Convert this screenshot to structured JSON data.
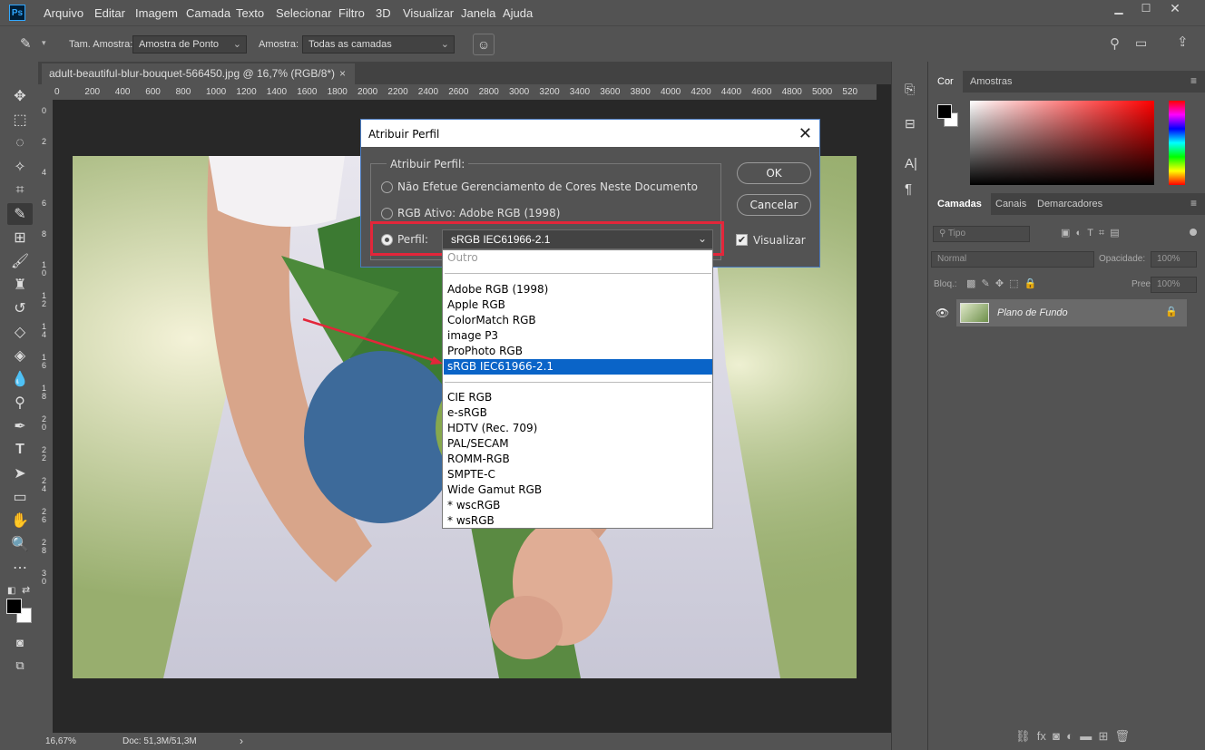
{
  "app": {
    "logo": "Ps"
  },
  "menu": [
    "Arquivo",
    "Editar",
    "Imagem",
    "Camada",
    "Texto",
    "Selecionar",
    "Filtro",
    "3D",
    "Visualizar",
    "Janela",
    "Ajuda"
  ],
  "options": {
    "sample_size_label": "Tam. Amostra:",
    "sample_size_value": "Amostra de Ponto",
    "sample_label": "Amostra:",
    "sample_value": "Todas as camadas"
  },
  "document": {
    "tab_title": "adult-beautiful-blur-bouquet-566450.jpg @ 16,7% (RGB/8*)",
    "tab_close": "×",
    "ruler_h": [
      "0",
      "200",
      "400",
      "600",
      "800",
      "1000",
      "1200",
      "1400",
      "1600",
      "1800",
      "2000",
      "2200",
      "2400",
      "2600",
      "2800",
      "3000",
      "3200",
      "3400",
      "3600",
      "3800",
      "4000",
      "4200",
      "4400",
      "4600",
      "4800",
      "5000",
      "520"
    ],
    "ruler_v": [
      "0",
      "2",
      "4",
      "6",
      "8",
      "1\n0",
      "1\n2",
      "1\n4",
      "1\n6",
      "1\n8",
      "2\n0",
      "2\n2",
      "2\n4",
      "2\n6",
      "2\n8",
      "3\n0"
    ]
  },
  "status": {
    "zoom": "16,67%",
    "doc": "Doc: 51,3M/51,3M",
    "arrow": "›"
  },
  "dialog": {
    "title": "Atribuir Perfil",
    "close": "✕",
    "group_label": "Atribuir Perfil:",
    "option1": "Não Efetue Gerenciamento de Cores Neste Documento",
    "option2": "RGB Ativo: Adobe RGB (1998)",
    "option3_label": "Perfil:",
    "profile_value": "sRGB IEC61966-2.1",
    "ok": "OK",
    "cancel": "Cancelar",
    "preview": "Visualizar"
  },
  "dropdown": {
    "header": "Outro",
    "group1": [
      "Adobe RGB (1998)",
      "Apple RGB",
      "ColorMatch RGB",
      "image P3",
      "ProPhoto RGB",
      "sRGB IEC61966-2.1"
    ],
    "group2": [
      "CIE RGB",
      "e-sRGB",
      "HDTV (Rec. 709)",
      "PAL/SECAM",
      "ROMM-RGB",
      "SMPTE-C",
      "Wide Gamut RGB",
      "* wscRGB",
      "* wsRGB"
    ],
    "selected": "sRGB IEC61966-2.1"
  },
  "panels": {
    "color_tabs": [
      "Cor",
      "Amostras"
    ],
    "layer_tabs": [
      "Camadas",
      "Canais",
      "Demarcadores"
    ],
    "filter_kind": "Tipo",
    "blend_mode": "Normal",
    "opacity_label": "Opacidade:",
    "opacity_value": "100%",
    "lock_label": "Bloq.:",
    "fill_label": "Preen.:",
    "fill_value": "100%",
    "layer_name": "Plano de Fundo"
  }
}
